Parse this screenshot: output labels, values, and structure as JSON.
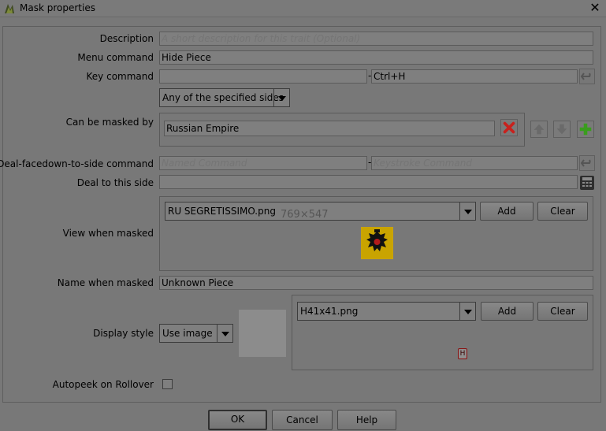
{
  "window": {
    "title": "Mask properties"
  },
  "fields": {
    "description": {
      "label": "Description",
      "value": "",
      "placeholder": "A short description for this trait (Optional)"
    },
    "menu_command": {
      "label": "Menu command",
      "value": "Hide Piece"
    },
    "key_command": {
      "label": "Key command",
      "value": "",
      "keystroke": "Ctrl+H",
      "separator": "-"
    },
    "sides_option": {
      "selected": "Any of the specified sides"
    },
    "can_be_masked_by": {
      "label": "Can be masked by",
      "value": "Russian Empire"
    },
    "deal_facedown": {
      "label": "Deal-facedown-to-side command",
      "command_placeholder": "Named Command",
      "keystroke_placeholder": "Keystroke Command",
      "separator": "-"
    },
    "deal_to_side": {
      "label": "Deal to this side",
      "value": ""
    },
    "view_when_masked": {
      "label": "View when masked",
      "image": "RU SEGRETISSIMO.png",
      "size_text": "769×547",
      "add_label": "Add",
      "clear_label": "Clear"
    },
    "name_when_masked": {
      "label": "Name when masked",
      "value": "Unknown Piece"
    },
    "display_style": {
      "label": "Display style",
      "selected": "Use image",
      "image": "H41x41.png",
      "add_label": "Add",
      "clear_label": "Clear",
      "preview_glyph": "H"
    },
    "autopeek": {
      "label": "Autopeek on Rollover",
      "checked": false
    }
  },
  "footer": {
    "ok_label": "OK",
    "cancel_label": "Cancel",
    "help_label": "Help"
  },
  "icons": {
    "app": "vassal-app-icon",
    "close": "close-icon",
    "undo": "undo-icon",
    "remove": "remove-icon",
    "up": "arrow-up-icon",
    "down": "arrow-down-icon",
    "add": "add-icon",
    "calculator": "calculator-icon",
    "eagle": "imperial-eagle-icon"
  },
  "colors": {
    "remove": "#c8211d",
    "add": "#3a9d1e",
    "eagle_bg": "#c9a400"
  }
}
